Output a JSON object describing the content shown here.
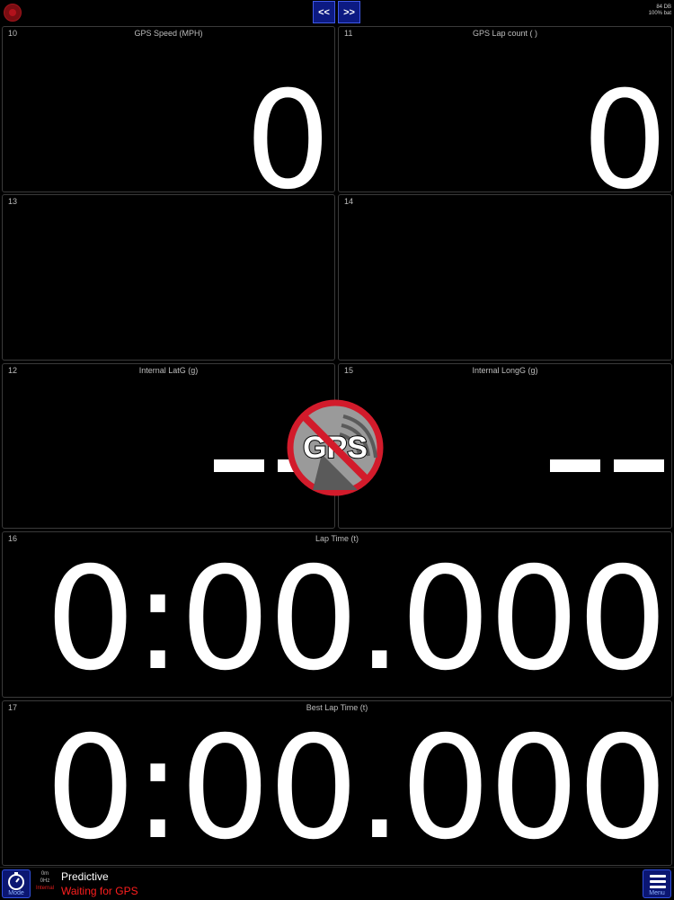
{
  "colors": {
    "background": "#000000",
    "accent_blue": "#0c1a82",
    "warning_red": "#ff1e1e",
    "gps_badge_red": "#d21b2b"
  },
  "topbar": {
    "prev_label": "<<",
    "next_label": ">>",
    "status_line1": "84 DB",
    "status_line2": "100% bat"
  },
  "tiles": {
    "t10": {
      "number": "10",
      "title": "GPS Speed (MPH)",
      "value": "0"
    },
    "t11": {
      "number": "11",
      "title": "GPS Lap count ( )",
      "value": "0"
    },
    "t13": {
      "number": "13"
    },
    "t14": {
      "number": "14"
    },
    "t12": {
      "number": "12",
      "title": "Internal LatG (g)",
      "value": "--"
    },
    "t15": {
      "number": "15",
      "title": "Internal LongG (g)",
      "value": "--"
    },
    "t16": {
      "number": "16",
      "title": "Lap Time (t)",
      "value": "0:00.000"
    },
    "t17": {
      "number": "17",
      "title": "Best Lap Time (t)",
      "value": "0:00.000"
    }
  },
  "gps_overlay": {
    "text": "GPS",
    "icon": "no-gps-satellite-icon"
  },
  "bottombar": {
    "mode_label": "Mode",
    "menu_label": "Menu",
    "mini_line1": "0m",
    "mini_line2": "0Hz",
    "mini_line3": "Internal",
    "mode_name": "Predictive",
    "status_text": "Waiting for GPS"
  }
}
